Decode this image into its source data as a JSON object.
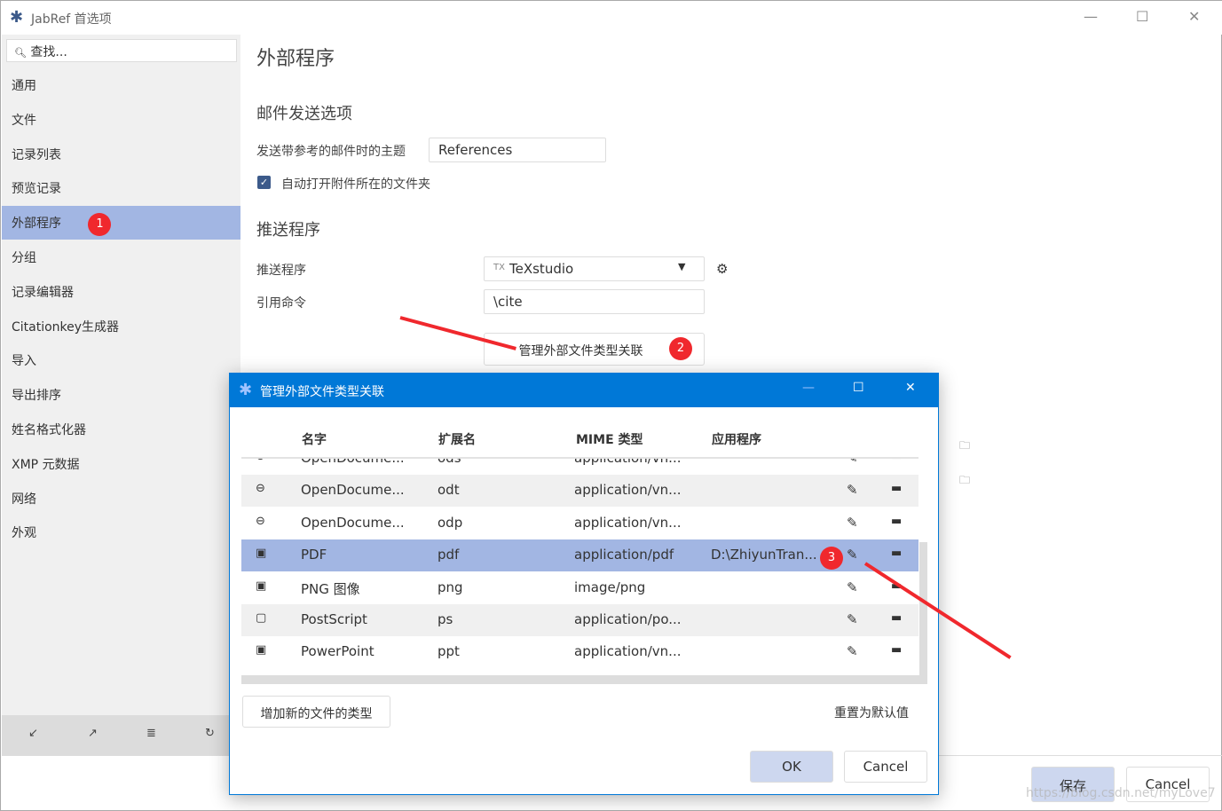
{
  "window": {
    "title": "JabRef 首选项",
    "minimize": "—",
    "maximize": "☐",
    "close": "✕"
  },
  "sidebar": {
    "search_placeholder": "查找...",
    "items": [
      {
        "label": "通用"
      },
      {
        "label": "文件"
      },
      {
        "label": "记录列表"
      },
      {
        "label": "预览记录"
      },
      {
        "label": "外部程序",
        "selected": true,
        "badge": "1"
      },
      {
        "label": "分组"
      },
      {
        "label": "记录编辑器"
      },
      {
        "label": "Citationkey生成器"
      },
      {
        "label": "导入"
      },
      {
        "label": "导出排序"
      },
      {
        "label": "姓名格式化器"
      },
      {
        "label": "XMP 元数据"
      },
      {
        "label": "网络"
      },
      {
        "label": "外观"
      }
    ],
    "bottom_icons": [
      "↙",
      "↗",
      "≣",
      "↻"
    ]
  },
  "main": {
    "title": "外部程序",
    "email_section": "邮件发送选项",
    "email_subject_label": "发送带参考的邮件时的主题",
    "email_subject_value": "References",
    "auto_open_label": "自动打开附件所在的文件夹",
    "auto_open_checked": true,
    "push_section": "推送程序",
    "push_label": "推送程序",
    "push_value": "TeXstudio",
    "cite_label": "引用命令",
    "cite_value": "\\cite",
    "manage_button": "管理外部文件类型关联",
    "manage_badge": "2",
    "save": "保存",
    "cancel": "Cancel"
  },
  "dialog": {
    "title": "管理外部文件类型关联",
    "columns": [
      "名字",
      "扩展名",
      "MIME 类型",
      "应用程序"
    ],
    "rows": [
      {
        "icon": "⊖",
        "name": "OpenDocume...",
        "ext": "ods",
        "mime": "application/vn...",
        "app": ""
      },
      {
        "icon": "⊖",
        "name": "OpenDocume...",
        "ext": "odt",
        "mime": "application/vn...",
        "app": ""
      },
      {
        "icon": "⊖",
        "name": "OpenDocume...",
        "ext": "odp",
        "mime": "application/vn...",
        "app": ""
      },
      {
        "icon": "▣",
        "name": "PDF",
        "ext": "pdf",
        "mime": "application/pdf",
        "app": "D:\\ZhiyunTran...",
        "selected": true
      },
      {
        "icon": "▣",
        "name": "PNG 图像",
        "ext": "png",
        "mime": "image/png",
        "app": ""
      },
      {
        "icon": "▢",
        "name": "PostScript",
        "ext": "ps",
        "mime": "application/po...",
        "app": ""
      },
      {
        "icon": "▣",
        "name": "PowerPoint",
        "ext": "ppt",
        "mime": "application/vn...",
        "app": ""
      }
    ],
    "edit_badge": "3",
    "add_button": "增加新的文件的类型",
    "reset_button": "重置为默认值",
    "ok": "OK",
    "cancel": "Cancel"
  },
  "watermark": "https://blog.csdn.net/myLove7",
  "colors": {
    "accent": "#0078d7",
    "selection": "#a2b6e3",
    "badge": "#f0282d"
  }
}
